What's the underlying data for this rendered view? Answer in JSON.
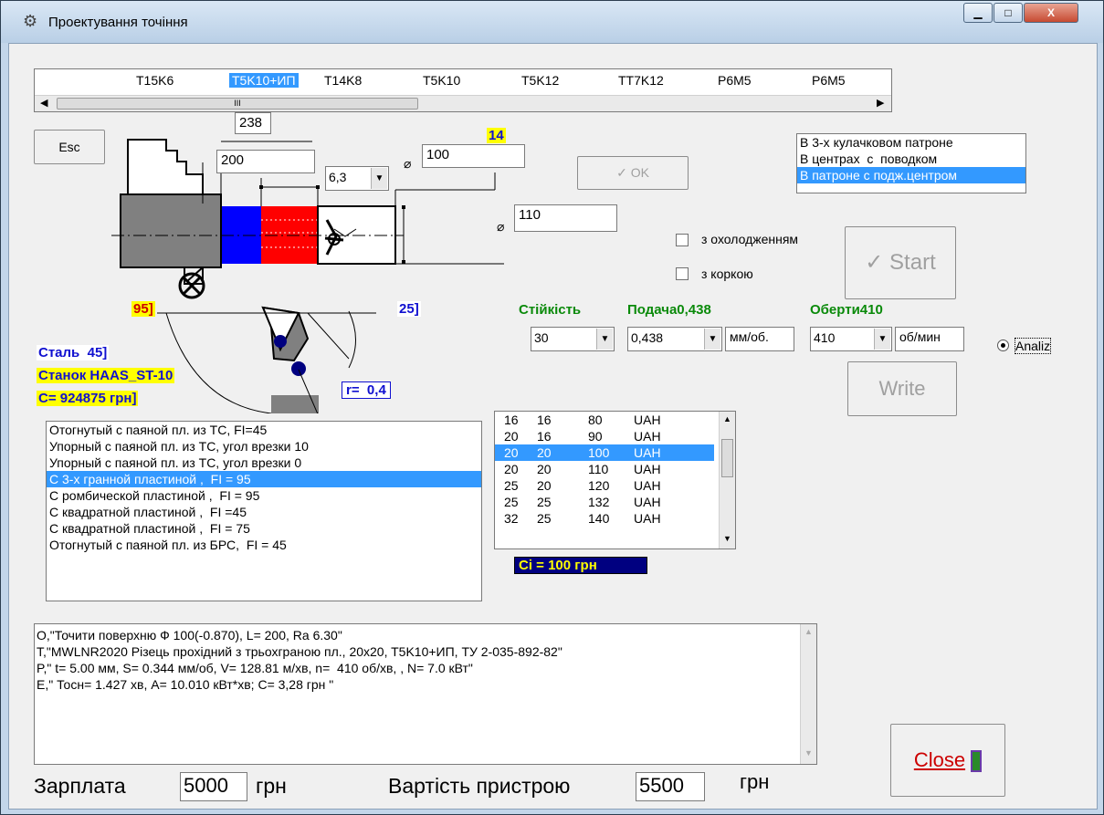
{
  "window": {
    "title": "Проектування точіння",
    "min": "▁",
    "max": "□",
    "close": "X"
  },
  "materials": {
    "items": [
      "T15K6",
      "T5K10+ИП",
      "T14K8",
      "T5K10",
      "T5K12",
      "TT7K12",
      "P6M5",
      "P6M5"
    ],
    "selected": 1,
    "thumb": "III"
  },
  "esc_label": "Esc",
  "dims": {
    "d238": "238",
    "d200": "200",
    "ra": "6,3",
    "top_num": "14",
    "diam100": "100",
    "diam110": "110",
    "ang95": "95",
    "ang25": "25",
    "r": "r=  0,4",
    "phi_sym": "⌀"
  },
  "ok_label": "OK",
  "fixture": {
    "items": [
      "В 3-х кулачковом патроне",
      "В центрах  с  поводком",
      "В патроне с подж.центром"
    ],
    "selected": 2
  },
  "checks": {
    "cool": "з охолодженням",
    "crust": "з коркою"
  },
  "start_label": "Start",
  "write_label": "Write",
  "params": {
    "stiff_label": "Стійкість",
    "feed_label": "Подача0,438",
    "rot_label": "Оберти410",
    "stiff": "30",
    "feed": "0,438",
    "feed_unit": "мм/об.",
    "rot": "410",
    "rot_unit": "об/мин"
  },
  "analiz": "Analiz",
  "info": {
    "steel": "Сталь  45",
    "machine": "Станок HAAS_ST-10",
    "cost": "С= 924875 грн"
  },
  "tools": {
    "items": [
      "Отогнутый с паяной пл. из ТС, FI=45",
      "Упорный с паяной пл. из ТС, угол врезки 10",
      "Упорный с паяной пл. из ТС, угол врезки 0",
      "С 3-х гранной пластиной ,  FI = 95",
      "С ромбической пластиной ,  FI = 95",
      "С квадратной пластиной ,  FI =45",
      "С квадратной пластиной ,  FI = 75",
      "Отогнутый с паяной пл. из БРС,  FI = 45"
    ],
    "selected": 3
  },
  "holders": {
    "rows": [
      [
        "16",
        "16",
        "80",
        "UAH"
      ],
      [
        "20",
        "16",
        "90",
        "UAH"
      ],
      [
        "20",
        "20",
        "100",
        "UAH"
      ],
      [
        "20",
        "20",
        "110",
        "UAH"
      ],
      [
        "25",
        "20",
        "120",
        "UAH"
      ],
      [
        "25",
        "25",
        "132",
        "UAH"
      ],
      [
        "32",
        "25",
        "140",
        "UAH"
      ]
    ],
    "selected": 2
  },
  "ci": "Ci = 100 грн",
  "output": [
    "O,\"Точити поверхню Ф 100(-0.870), L= 200, Ra 6.30\"",
    "T,\"MWLNR2020 Різець прохідний з трьохграною пл., 20x20, T5K10+ИП, ТУ 2-035-892-82\"",
    "P,\" t= 5.00 мм, S= 0.344 мм/об, V= 128.81 м/хв, n=  410 об/хв, , N= 7.0 кВт\"",
    "E,\" Тосн= 1.427 хв, A= 10.010 кВт*хв; С= 3,28 грн \""
  ],
  "salary": {
    "label": "Зарплата",
    "value": "5000",
    "unit": "грн"
  },
  "fixture_cost": {
    "label": "Вартість пристрою",
    "value": "5500",
    "unit": "грн"
  },
  "close_label": "Close"
}
